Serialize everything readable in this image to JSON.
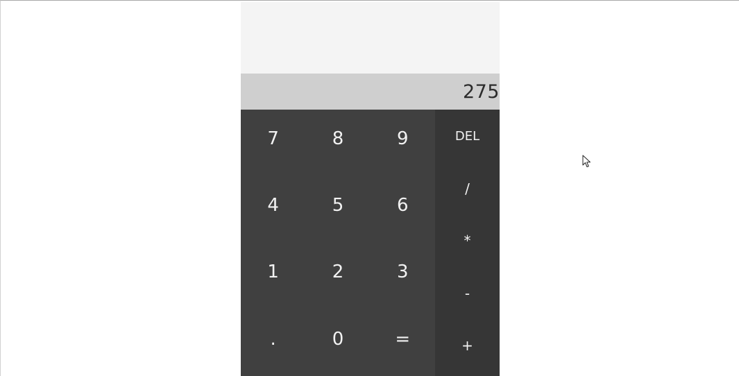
{
  "display": {
    "result": "275"
  },
  "keypad": {
    "numbers": {
      "k7": "7",
      "k8": "8",
      "k9": "9",
      "k4": "4",
      "k5": "5",
      "k6": "6",
      "k1": "1",
      "k2": "2",
      "k3": "3",
      "decimal": ".",
      "k0": "0",
      "equals": "="
    },
    "operators": {
      "del": "DEL",
      "divide": "/",
      "multiply": "*",
      "subtract": "-",
      "add": "+"
    }
  },
  "colors": {
    "history_bg": "#f4f4f4",
    "result_bg": "#cfcfcf",
    "number_pad_bg": "#404040",
    "operator_pad_bg": "#363636",
    "key_text": "#f2f2f2"
  }
}
